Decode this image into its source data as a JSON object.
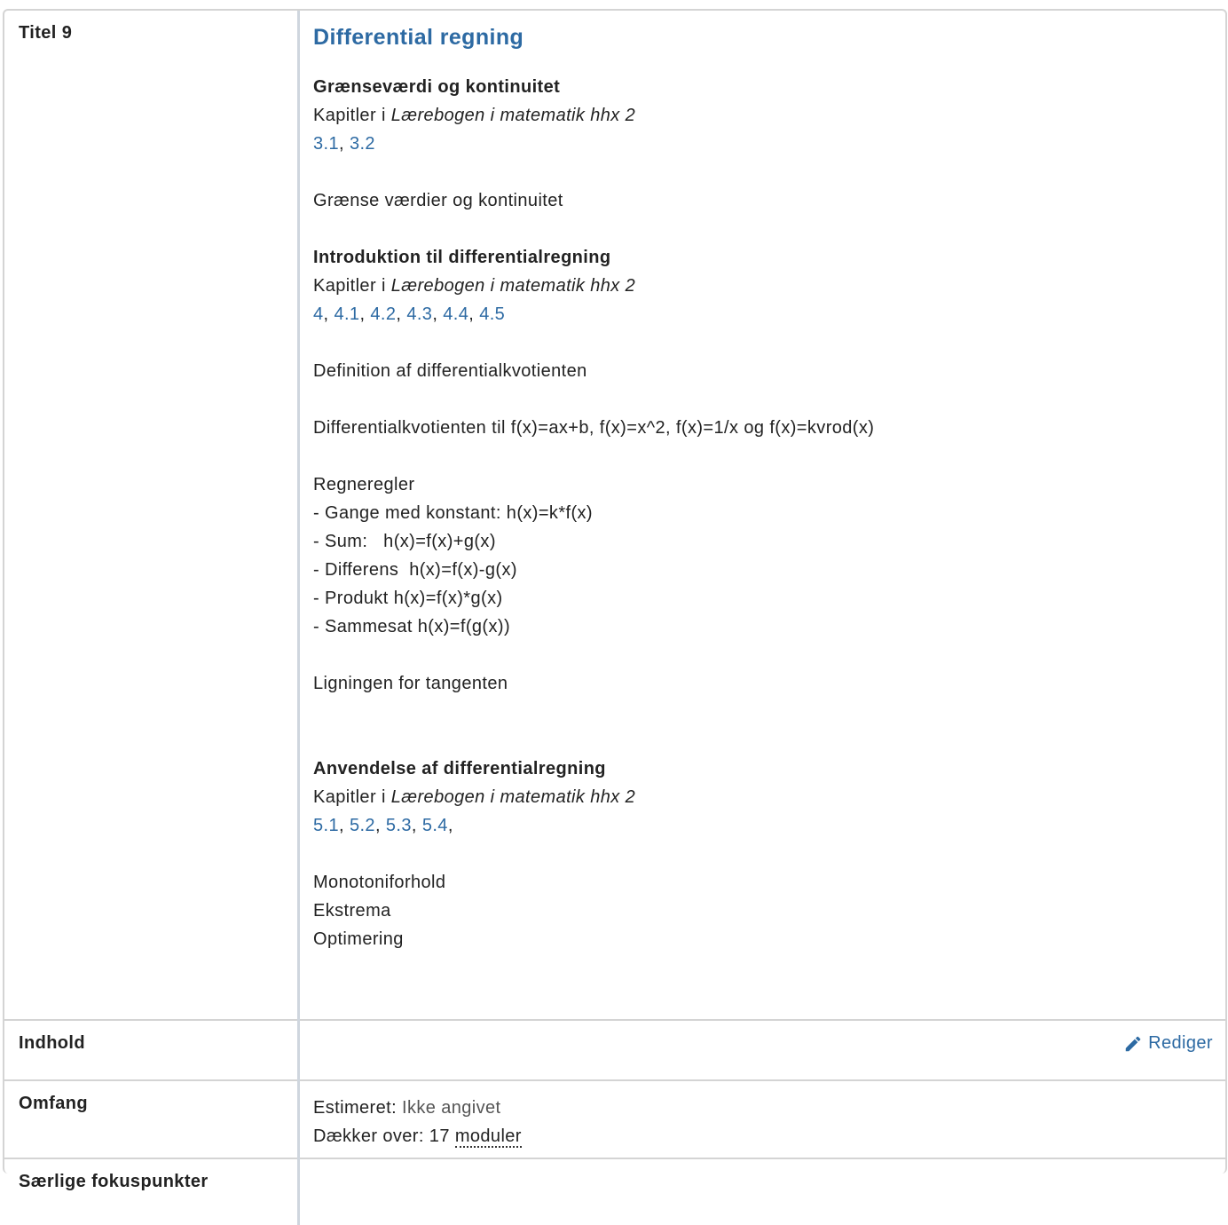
{
  "row_title": {
    "label": "Titel 9",
    "heading": "Differential regning"
  },
  "sections": [
    {
      "title": "Grænseværdi og kontinuitet",
      "book_prefix": "Kapitler i ",
      "book_title": "Lærebogen i matematik hhx 2",
      "links": [
        "3.1",
        "3.2"
      ]
    },
    {
      "title": "Introduktion til differentialregning",
      "book_prefix": "Kapitler i ",
      "book_title": "Lærebogen i matematik hhx 2",
      "links": [
        "4",
        "4.1",
        "4.2",
        "4.3",
        "4.4",
        "4.5"
      ]
    },
    {
      "title": "Anvendelse af differentialregning",
      "book_prefix": "Kapitler i ",
      "book_title": "Lærebogen i matematik hhx 2",
      "links": [
        "5.1",
        "5.2",
        "5.3",
        "5.4"
      ]
    }
  ],
  "text": {
    "t1": "Grænse værdier og kontinuitet",
    "t2": "Definition af differentialkvotienten",
    "t3": "Differentialkvotienten til f(x)=ax+b, f(x)=x^2, f(x)=1/x og f(x)=kvrod(x)",
    "t4": "Regneregler",
    "t5": "- Gange med konstant: h(x)=k*f(x)",
    "t6": "- Sum:   h(x)=f(x)+g(x)",
    "t7": "- Differens  h(x)=f(x)-g(x)",
    "t8": "- Produkt h(x)=f(x)*g(x)",
    "t9": "- Sammesat h(x)=f(g(x))",
    "t10": "Ligningen for tangenten",
    "t11": "Monotoniforhold",
    "t12": "Ekstrema",
    "t13": "Optimering"
  },
  "indhold": {
    "label": "Indhold",
    "edit_label": "Rediger"
  },
  "omfang": {
    "label": "Omfang",
    "estimated_label": "Estimeret: ",
    "estimated_value": "Ikke angivet",
    "covers_label": "Dækker over: ",
    "covers_count": "17",
    "covers_unit": "moduler"
  },
  "fokus": {
    "label": "Særlige fokuspunkter"
  },
  "colors": {
    "link": "#2d6aa3",
    "border": "#d4d4d4"
  }
}
